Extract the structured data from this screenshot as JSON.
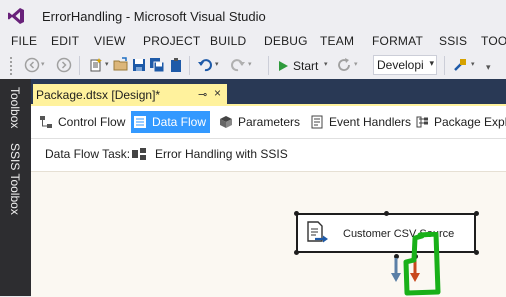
{
  "window": {
    "title": "ErrorHandling - Microsoft Visual Studio"
  },
  "menu": {
    "items": [
      "FILE",
      "EDIT",
      "VIEW",
      "PROJECT",
      "BUILD",
      "DEBUG",
      "TEAM",
      "FORMAT",
      "SSIS",
      "TOO"
    ]
  },
  "toolbar": {
    "start_label": "Start",
    "configuration": "Developi"
  },
  "side_panel": {
    "tabs": [
      "Toolbox",
      "SSIS Toolbox"
    ]
  },
  "document_tab": {
    "label": "Package.dtsx [Design]*"
  },
  "designer": {
    "tabs": [
      "Control Flow",
      "Data Flow",
      "Parameters",
      "Event Handlers",
      "Package Explo"
    ],
    "active_tab": "Data Flow",
    "task_label": "Data Flow Task:",
    "task_value": "Error Handling with SSIS",
    "component_label": "Customer CSV Source"
  },
  "colors": {
    "accent_tab": "#3399ff",
    "doc_tab": "#fff29d",
    "tab_row": "#293955",
    "annotation": "#19b019",
    "error_arrow": "#c8481e",
    "data_arrow": "#5b7fa6"
  },
  "icons": {
    "vs_logo": "visual-studio-logo-icon",
    "play": "play-icon",
    "source": "flat-file-source-icon"
  }
}
